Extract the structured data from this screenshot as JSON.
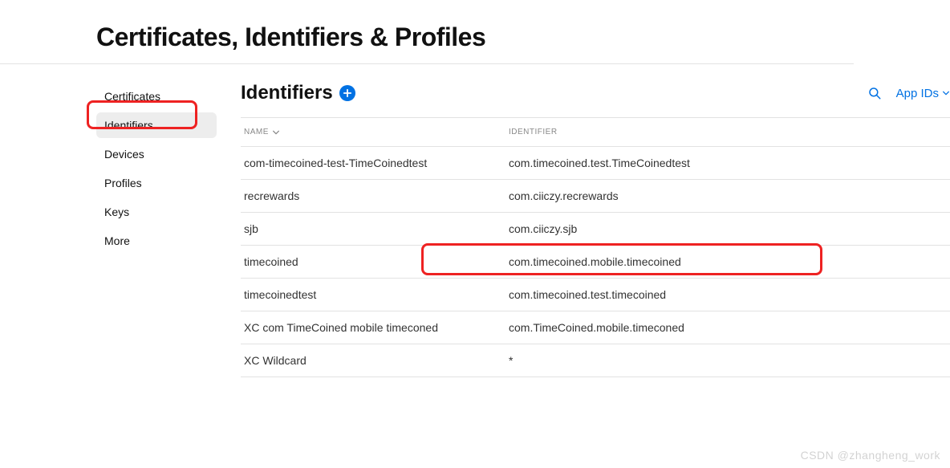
{
  "page_title": "Certificates, Identifiers & Profiles",
  "sidebar": {
    "items": [
      {
        "label": "Certificates",
        "active": false
      },
      {
        "label": "Identifiers",
        "active": true
      },
      {
        "label": "Devices",
        "active": false
      },
      {
        "label": "Profiles",
        "active": false
      },
      {
        "label": "Keys",
        "active": false
      },
      {
        "label": "More",
        "active": false
      }
    ]
  },
  "section": {
    "title": "Identifiers",
    "filter_label": "App IDs"
  },
  "table": {
    "columns": {
      "name": "NAME",
      "identifier": "IDENTIFIER"
    },
    "rows": [
      {
        "name": "com-timecoined-test-TimeCoinedtest",
        "identifier": "com.timecoined.test.TimeCoinedtest"
      },
      {
        "name": "recrewards",
        "identifier": "com.ciiczy.recrewards"
      },
      {
        "name": "sjb",
        "identifier": "com.ciiczy.sjb"
      },
      {
        "name": "timecoined",
        "identifier": "com.timecoined.mobile.timecoined"
      },
      {
        "name": "timecoinedtest",
        "identifier": "com.timecoined.test.timecoined"
      },
      {
        "name": "XC com TimeCoined mobile timeconed",
        "identifier": "com.TimeCoined.mobile.timeconed"
      },
      {
        "name": "XC Wildcard",
        "identifier": "*"
      }
    ]
  },
  "watermark": "CSDN @zhangheng_work",
  "highlight": {
    "sidebar_index": 1,
    "row_index": 1
  }
}
